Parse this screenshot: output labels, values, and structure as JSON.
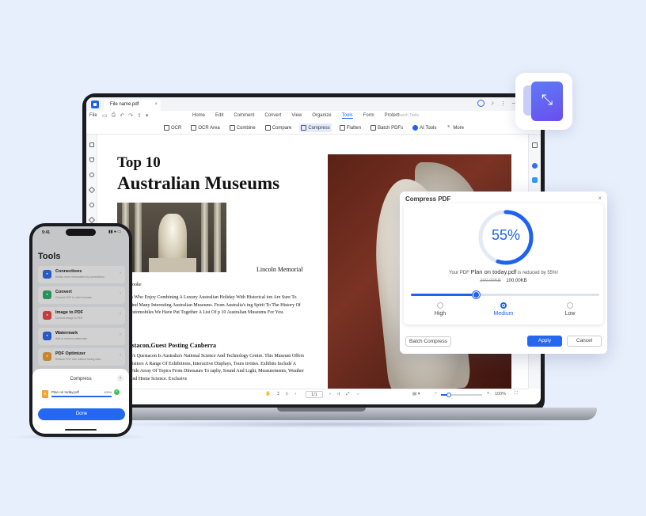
{
  "desktop": {
    "tab_name": "File name.pdf",
    "tab_close": "×",
    "file_menu": "File",
    "menu": [
      "Home",
      "Edit",
      "Comment",
      "Convert",
      "View",
      "Organize",
      "Tools",
      "Form",
      "Protect"
    ],
    "active_menu": "Tools",
    "search_placeholder": "Search Tools",
    "tools": [
      {
        "label": "OCR",
        "icon": "ocr-icon"
      },
      {
        "label": "OCR Area",
        "icon": "ocr-area-icon"
      },
      {
        "label": "Combine",
        "icon": "combine-icon"
      },
      {
        "label": "Compare",
        "icon": "compare-icon"
      },
      {
        "label": "Compress",
        "icon": "compress-icon"
      },
      {
        "label": "Flatten",
        "icon": "flatten-icon"
      },
      {
        "label": "Batch PDFs",
        "icon": "batch-icon"
      },
      {
        "label": "AI Tools",
        "icon": "ai-icon"
      },
      {
        "label": "More",
        "icon": "more-icon"
      }
    ],
    "active_tool": "Compress",
    "accent": "#1e63f0"
  },
  "document": {
    "title_line1": "Top 10",
    "title_line2": "Australian Museums",
    "image_caption": "Lincoln Memorial",
    "author": "Cooke",
    "para1": "es Who Enjoy Combining A Luxury Australian Holiday With Historical ion Are Sure To Find Many Interesting Australian Museums. From Australia's ing Spirit To The History Of Automobiles We Have Put Together A List Of p 10 Australian Museums For You.",
    "subhead": "estacon,Guest Posting Canberra",
    "para2": "ra's Questacon Is Australia's National Science And Technology Centre. This Museum Offers Visitors A Range Of Exhibitions, Interactive Displays, Tours tivities. Exhibits Include A Wide Array Of Topics From Dinosaurs To raphy, Sound And Light, Measurements, Weather And Home Science. Exclusive"
  },
  "statusbar": {
    "page": "1/1",
    "zoom": "100%",
    "zoom_fraction": 0.2
  },
  "dialog": {
    "title": "Compress PDF",
    "close": "×",
    "percent": "55%",
    "percent_value": 0.55,
    "reduced_prefix": "Your PDF ",
    "file_name": "Plan on today.pdf",
    "reduced_suffix": " is reduced by 55%!",
    "old_size": "200.00KB",
    "new_size": "100.00KB",
    "options": [
      "High",
      "Medium",
      "Low"
    ],
    "selected_option": "Medium",
    "slider_value": 0.35,
    "batch_label": "Batch Compress",
    "apply_label": "Apply",
    "cancel_label": "Cancel"
  },
  "phone": {
    "time": "9:41",
    "status": "▮▮ ● ▭",
    "title": "Tools",
    "tools": [
      {
        "name": "Connections",
        "desc": "Switch more information by connections",
        "color": "#2f6df5",
        "icon": "link-icon"
      },
      {
        "name": "Convert",
        "desc": "Convert PDF to other formats",
        "color": "#2fb36e",
        "icon": "convert-icon"
      },
      {
        "name": "Image to PDF",
        "desc": "Convert image to PDF",
        "color": "#ef4b4b",
        "icon": "image-icon"
      },
      {
        "name": "Watermark",
        "desc": "Add or remove watermark",
        "color": "#2f6df5",
        "icon": "watermark-icon"
      },
      {
        "name": "PDF Optimizer",
        "desc": "Reduce PDF size without losing data",
        "color": "#f2a33a",
        "icon": "optimizer-icon"
      }
    ],
    "sheet_title": "Compress",
    "sheet_close": "×",
    "sheet_file": "Plan on today.pdf",
    "sheet_percent": "100%",
    "sheet_progress": 1.0,
    "done_label": "Done"
  }
}
